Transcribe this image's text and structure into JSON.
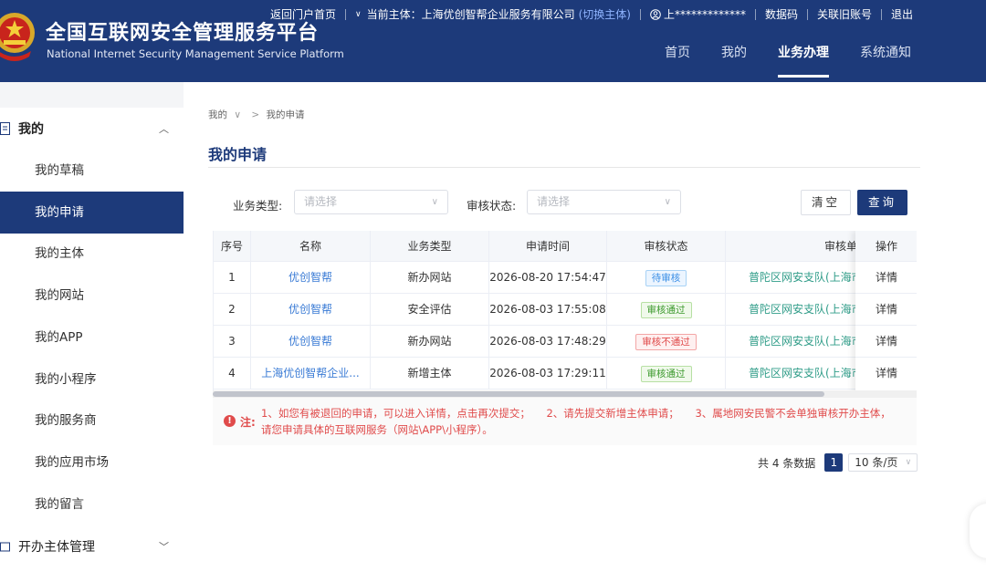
{
  "header": {
    "title_cn": "全国互联网安全管理服务平台",
    "title_en": "National Internet Security Management Service Platform",
    "top_links": {
      "portal": "返回门户首页",
      "current_entity_label": "当前主体：上海优创智帮企业服务有限公司",
      "switch_entity": "(切换主体)",
      "user": "上*************",
      "digital_code": "数据码",
      "link_old_account": "关联旧账号",
      "logout": "退出"
    },
    "nav": [
      {
        "label": "首页"
      },
      {
        "label": "我的"
      },
      {
        "label": "业务办理"
      },
      {
        "label": "系统通知"
      }
    ]
  },
  "sidebar": {
    "group_my": "我的",
    "items": [
      {
        "label": "我的草稿"
      },
      {
        "label": "我的申请"
      },
      {
        "label": "我的主体"
      },
      {
        "label": "我的网站"
      },
      {
        "label": "我的APP"
      },
      {
        "label": "我的小程序"
      },
      {
        "label": "我的服务商"
      },
      {
        "label": "我的应用市场"
      },
      {
        "label": "我的留言"
      }
    ],
    "group_entity": "开办主体管理"
  },
  "breadcrumb": {
    "root": "我的",
    "current": "我的申请"
  },
  "page": {
    "title": "我的申请"
  },
  "filters": {
    "business_type_label": "业务类型:",
    "business_type_placeholder": "请选择",
    "audit_status_label": "审核状态:",
    "audit_status_placeholder": "请选择",
    "clear_label": "清空",
    "query_label": "查询"
  },
  "table": {
    "columns": [
      "序号",
      "名称",
      "业务类型",
      "申请时间",
      "审核状态",
      "审核单",
      "操作"
    ],
    "rows": [
      {
        "index": "1",
        "name": "优创智帮",
        "type": "新办网站",
        "time": "2026-08-20 17:54:47",
        "status": "待审核",
        "status_kind": "pending",
        "unit": "普陀区网安支队(上海市",
        "action": "详情"
      },
      {
        "index": "2",
        "name": "优创智帮",
        "type": "安全评估",
        "time": "2026-08-03 17:55:08",
        "status": "审核通过",
        "status_kind": "pass",
        "unit": "普陀区网安支队(上海市",
        "action": "详情"
      },
      {
        "index": "3",
        "name": "优创智帮",
        "type": "新办网站",
        "time": "2026-08-03 17:48:29",
        "status": "审核不通过",
        "status_kind": "fail",
        "unit": "普陀区网安支队(上海市",
        "action": "详情"
      },
      {
        "index": "4",
        "name": "上海优创智帮企业...",
        "type": "新增主体",
        "time": "2026-08-03 17:29:11",
        "status": "审核通过",
        "status_kind": "pass",
        "unit": "普陀区网安支队(上海市",
        "action": "详情"
      }
    ]
  },
  "note": {
    "label": "注:",
    "line1a": "1、如您有被退回的申请，可以进入详情，点击再次提交；",
    "line1b": "2、请先提交新增主体申请；",
    "line1c": "3、属地网安民警不会单独审核开办主体，",
    "line2": "请您申请具体的互联网服务（网站\\APP\\小程序）。"
  },
  "pagination": {
    "total": "共 4 条数据",
    "current_page": "1",
    "page_size": "10 条/页"
  },
  "colors": {
    "brand": "#1d3a7a",
    "link": "#3a7bd5",
    "unit_link": "#2f9c88",
    "warning": "#e04b4b"
  }
}
